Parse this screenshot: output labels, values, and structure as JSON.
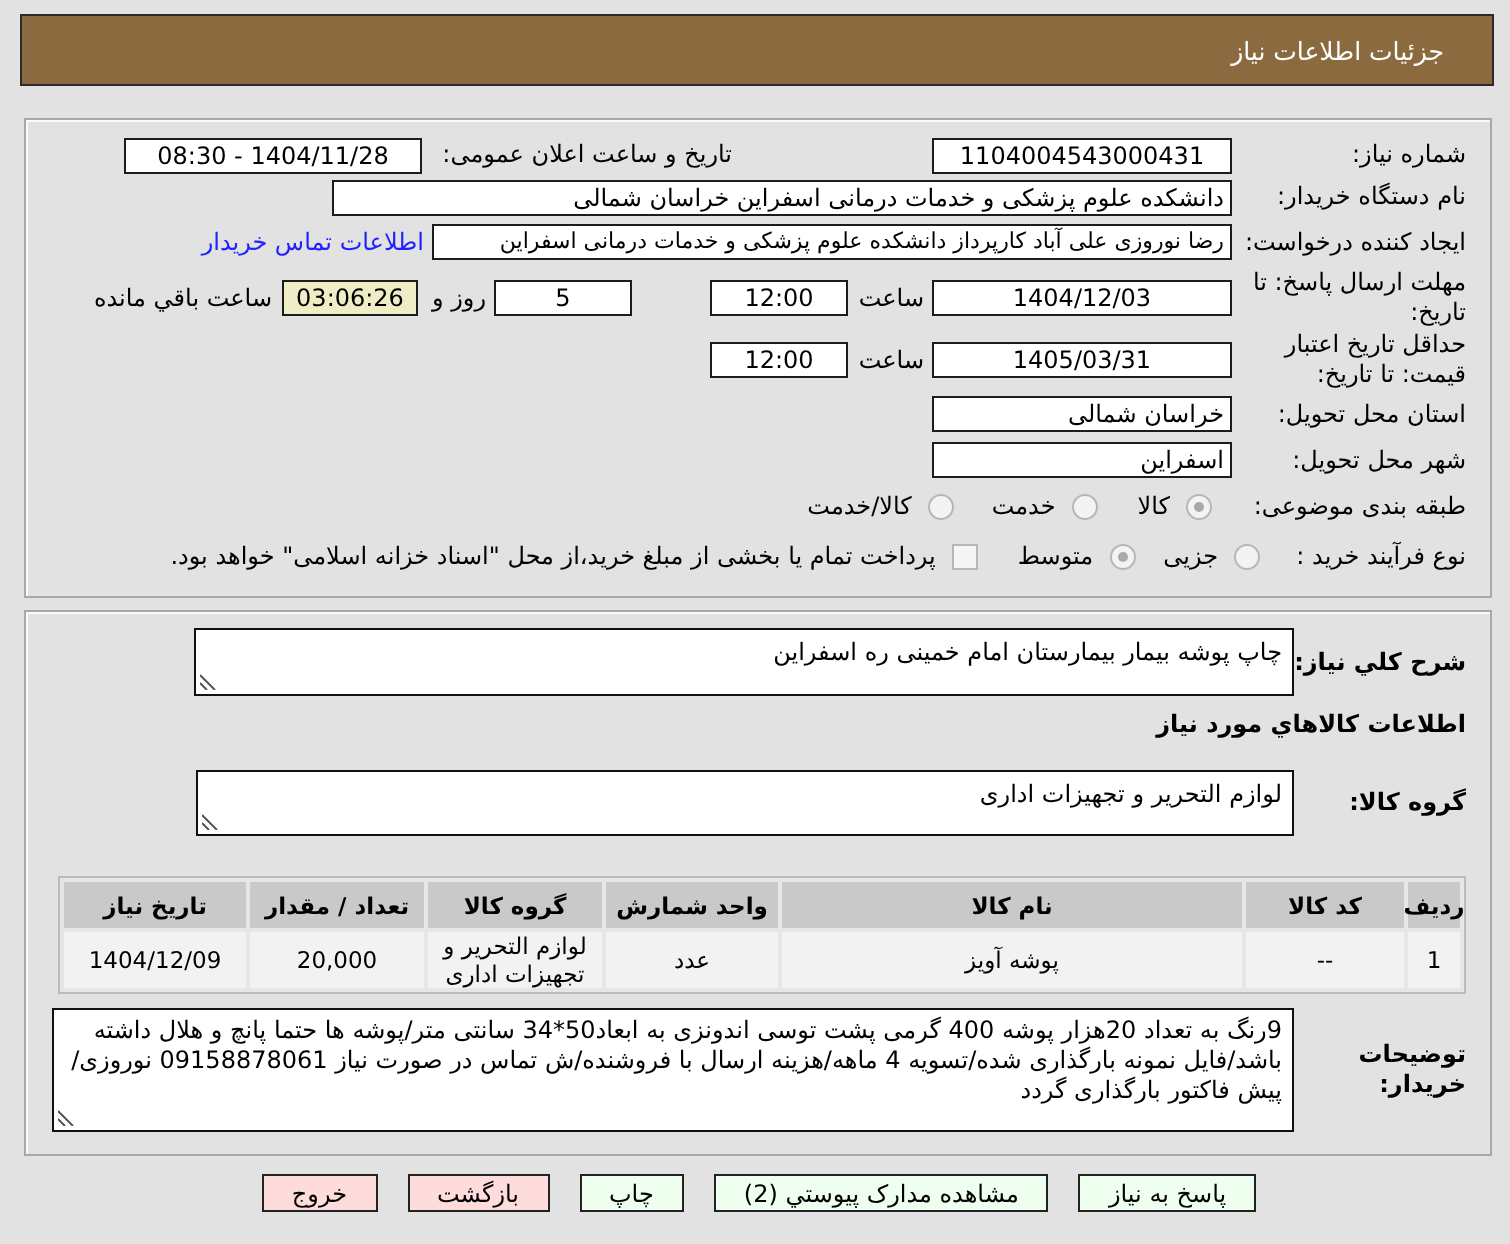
{
  "header": {
    "title": "جزئیات اطلاعات نیاز"
  },
  "details": {
    "need_number": {
      "label": "شماره نیاز:",
      "value": "1104004543000431"
    },
    "announcement": {
      "label": "تاریخ و ساعت اعلان عمومی:",
      "value": "1404/11/28 - 08:30"
    },
    "buyer_org": {
      "label": "نام دستگاه خریدار:",
      "value": "دانشکده علوم پزشکی و خدمات درمانی اسفراین خراسان شمالی"
    },
    "creator": {
      "label": "ایجاد کننده درخواست:",
      "value": "رضا نوروزی علی آباد کارپرداز دانشکده علوم پزشکی و خدمات درمانی اسفراین",
      "link": "اطلاعات تماس خریدار"
    },
    "deadline": {
      "label": "مهلت ارسال پاسخ: تا تاریخ:",
      "date": "1404/12/03",
      "time_label": "ساعت",
      "time": "12:00",
      "days": "5",
      "days_label": "روز و",
      "remaining": "03:06:26",
      "remaining_label": "ساعت باقي مانده"
    },
    "validity": {
      "label": "حداقل تاریخ اعتبار قیمت: تا تاریخ:",
      "date": "1405/03/31",
      "time_label": "ساعت",
      "time": "12:00"
    },
    "province": {
      "label": "استان محل تحویل:",
      "value": "خراسان شمالی"
    },
    "city": {
      "label": "شهر محل تحویل:",
      "value": "اسفراین"
    },
    "category": {
      "label": "طبقه بندی موضوعی:",
      "options": [
        {
          "label": "کالا",
          "selected": true
        },
        {
          "label": "خدمت",
          "selected": false
        },
        {
          "label": "کالا/خدمت",
          "selected": false
        }
      ]
    },
    "process": {
      "label": "نوع فرآیند خرید :",
      "options": [
        {
          "label": "جزیی",
          "selected": false
        },
        {
          "label": "متوسط",
          "selected": true
        }
      ],
      "payment": {
        "label": "پرداخت تمام یا بخشی از مبلغ خرید،از محل \"اسناد خزانه اسلامی\" خواهد بود.",
        "checked": false
      }
    }
  },
  "need": {
    "description": {
      "label": "شرح کلي نیاز:",
      "value": "چاپ پوشه بیمار بیمارستان امام خمینی ره اسفراین"
    },
    "goods_title": "اطلاعات کالاهاي مورد نیاز",
    "goods_group": {
      "label": "گروه کالا:",
      "value": "لوازم التحریر و تجهیزات اداری"
    },
    "table": {
      "columns": [
        "ردیف",
        "کد کالا",
        "نام کالا",
        "واحد شمارش",
        "گروه کالا",
        "تعداد / مقدار",
        "تاریخ نیاز"
      ],
      "rows": [
        [
          "1",
          "--",
          "پوشه آویز",
          "عدد",
          "لوازم التحریر و تجهیزات اداری",
          "20,000",
          "1404/12/09"
        ]
      ]
    },
    "buyer_notes": {
      "label": "توضیحات خریدار:",
      "value": "9رنگ به تعداد 20هزار پوشه 400 گرمی پشت توسی اندونزی به ابعاد50*34 سانتی متر/پوشه ها حتما پانچ و هلال داشته باشد/فایل نمونه بارگذاری شده/تسویه 4 ماهه/هزینه ارسال با فروشنده/ش تماس در صورت نیاز 09158878061 نوروزی/ پیش فاکتور بارگذاری گردد"
    }
  },
  "buttons": [
    {
      "label": "پاسخ به نیاز",
      "kind": "normal"
    },
    {
      "label": "مشاهده مدارک پیوستي (2)",
      "kind": "normal"
    },
    {
      "label": "چاپ",
      "kind": "normal"
    },
    {
      "label": "بازگشت",
      "kind": "warning"
    },
    {
      "label": "خروج",
      "kind": "warning"
    }
  ]
}
